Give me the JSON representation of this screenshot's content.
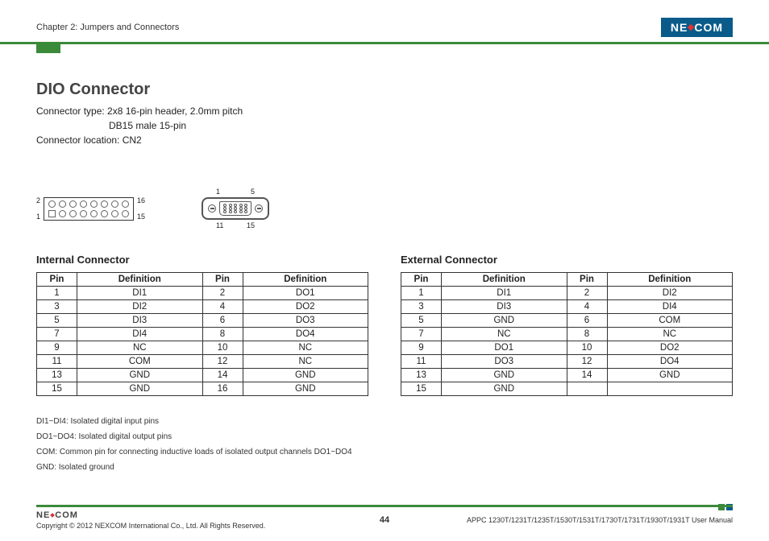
{
  "header": {
    "chapter": "Chapter 2: Jumpers and Connectors",
    "logo_left": "NE",
    "logo_right": "COM"
  },
  "title": "DIO Connector",
  "meta": {
    "type_label": "Connector type: 2x8 16-pin header, 2.0mm pitch",
    "type_line2": "DB15 male 15-pin",
    "location": "Connector location: CN2"
  },
  "diagram_header": {
    "tl": "2",
    "bl": "1",
    "tr": "16",
    "br": "15"
  },
  "diagram_db15": {
    "top_l": "1",
    "top_r": "5",
    "bot_l": "11",
    "bot_r": "15"
  },
  "tables": {
    "internal": {
      "title": "Internal Connector",
      "head_pin": "Pin",
      "head_def": "Definition",
      "rows": [
        {
          "p1": "1",
          "d1": "DI1",
          "p2": "2",
          "d2": "DO1"
        },
        {
          "p1": "3",
          "d1": "DI2",
          "p2": "4",
          "d2": "DO2"
        },
        {
          "p1": "5",
          "d1": "DI3",
          "p2": "6",
          "d2": "DO3"
        },
        {
          "p1": "7",
          "d1": "DI4",
          "p2": "8",
          "d2": "DO4"
        },
        {
          "p1": "9",
          "d1": "NC",
          "p2": "10",
          "d2": "NC"
        },
        {
          "p1": "11",
          "d1": "COM",
          "p2": "12",
          "d2": "NC"
        },
        {
          "p1": "13",
          "d1": "GND",
          "p2": "14",
          "d2": "GND"
        },
        {
          "p1": "15",
          "d1": "GND",
          "p2": "16",
          "d2": "GND"
        }
      ]
    },
    "external": {
      "title": "External Connector",
      "head_pin": "Pin",
      "head_def": "Definition",
      "rows": [
        {
          "p1": "1",
          "d1": "DI1",
          "p2": "2",
          "d2": "DI2"
        },
        {
          "p1": "3",
          "d1": "DI3",
          "p2": "4",
          "d2": "DI4"
        },
        {
          "p1": "5",
          "d1": "GND",
          "p2": "6",
          "d2": "COM"
        },
        {
          "p1": "7",
          "d1": "NC",
          "p2": "8",
          "d2": "NC"
        },
        {
          "p1": "9",
          "d1": "DO1",
          "p2": "10",
          "d2": "DO2"
        },
        {
          "p1": "11",
          "d1": "DO3",
          "p2": "12",
          "d2": "DO4"
        },
        {
          "p1": "13",
          "d1": "GND",
          "p2": "14",
          "d2": "GND"
        },
        {
          "p1": "15",
          "d1": "GND",
          "p2": "",
          "d2": ""
        }
      ]
    }
  },
  "notes": {
    "n1": "DI1~DI4: Isolated digital input pins",
    "n2": "DO1~DO4: Isolated digital output pins",
    "n3": "COM: Common pin for connecting inductive loads of isolated output channels DO1~DO4",
    "n4": "GND: Isolated ground"
  },
  "footer": {
    "logo_left": "NE",
    "logo_right": "COM",
    "copyright": "Copyright © 2012 NEXCOM International Co., Ltd. All Rights Reserved.",
    "page": "44",
    "manual": "APPC 1230T/1231T/1235T/1530T/1531T/1730T/1731T/1930T/1931T User Manual"
  }
}
